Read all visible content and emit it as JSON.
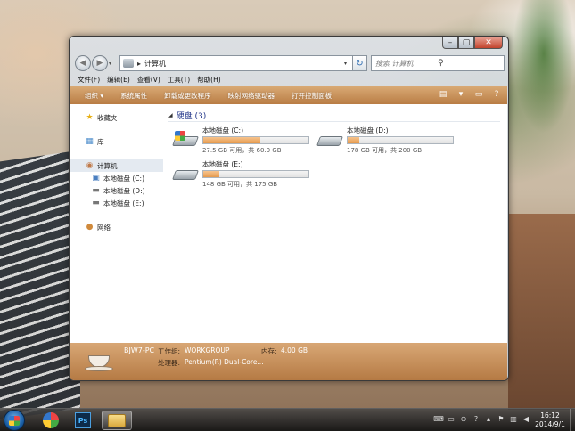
{
  "window": {
    "address": "计算机",
    "search_placeholder": "搜索 计算机",
    "caption": {
      "min": "–",
      "max": "▢",
      "close": "✕"
    }
  },
  "menu": [
    "文件(F)",
    "编辑(E)",
    "查看(V)",
    "工具(T)",
    "帮助(H)"
  ],
  "commands": [
    "组织 ▾",
    "系统属性",
    "卸载或更改程序",
    "映射网络驱动器",
    "打开控制面板"
  ],
  "sidebar": {
    "favorites": "收藏夹",
    "libraries": "库",
    "computer": "计算机",
    "drives": [
      "本地磁盘 (C:)",
      "本地磁盘 (D:)",
      "本地磁盘 (E:)"
    ],
    "network": "网络"
  },
  "content": {
    "group_title": "硬盘 (3)",
    "drives": [
      {
        "name": "本地磁盘 (C:)",
        "free": "27.5 GB 可用，共 60.0 GB",
        "used_fraction": 0.54
      },
      {
        "name": "本地磁盘 (D:)",
        "free": "178 GB 可用，共 200 GB",
        "used_fraction": 0.11
      },
      {
        "name": "本地磁盘 (E:)",
        "free": "148 GB 可用，共 175 GB",
        "used_fraction": 0.15
      }
    ]
  },
  "details": {
    "computer_name": "BJW7-PC",
    "workgroup_label": "工作组:",
    "workgroup": "WORKGROUP",
    "memory_label": "内存:",
    "memory": "4.00 GB",
    "processor_label": "处理器:",
    "processor": "Pentium(R) Dual-Core..."
  },
  "taskbar": {
    "time": "16:12",
    "date": "2014/9/1"
  },
  "colors": {
    "command_bar": "#c98c52",
    "group_title": "#1e3287",
    "bar_fill": "#e59a4d"
  }
}
